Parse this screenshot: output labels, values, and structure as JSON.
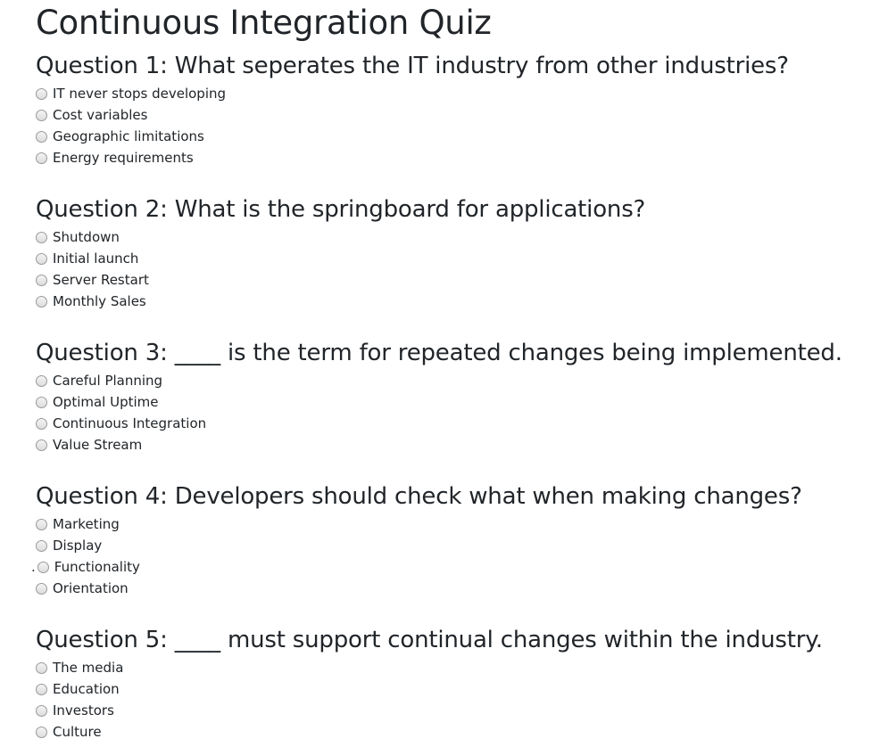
{
  "quiz": {
    "title": "Continuous Integration Quiz",
    "questions": [
      {
        "title": "Question 1: What seperates the IT industry from other industries?",
        "options": [
          "IT never stops developing",
          "Cost variables",
          "Geographic limitations",
          "Energy requirements"
        ]
      },
      {
        "title": "Question 2: What is the springboard for applications?",
        "options": [
          "Shutdown",
          "Initial launch",
          "Server Restart",
          "Monthly Sales"
        ]
      },
      {
        "title": "Question 3: ____ is the term for repeated changes being implemented.",
        "options": [
          "Careful Planning",
          "Optimal Uptime",
          "Continuous Integration",
          "Value Stream"
        ]
      },
      {
        "title": "Question 4: Developers should check what when making changes?",
        "options": [
          "Marketing",
          "Display",
          "Functionality",
          "Orientation"
        ],
        "stray_text": "."
      },
      {
        "title": "Question 5: ____ must support continual changes within the industry.",
        "options": [
          "The media",
          "Education",
          "Investors",
          "Culture"
        ]
      }
    ]
  }
}
